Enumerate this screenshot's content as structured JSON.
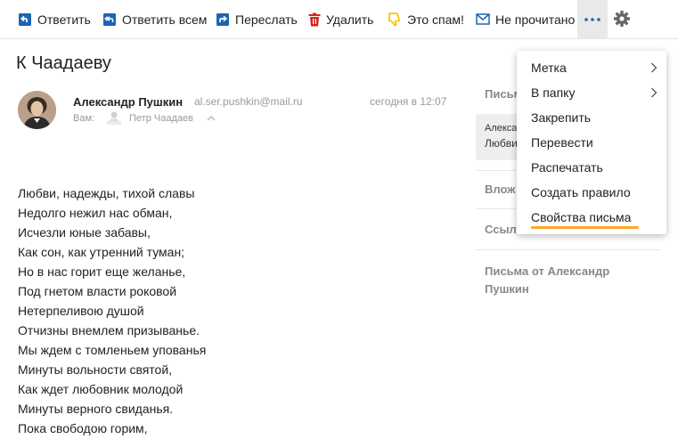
{
  "toolbar": {
    "reply": "Ответить",
    "reply_all": "Ответить всем",
    "forward": "Переслать",
    "delete": "Удалить",
    "spam": "Это спам!",
    "unread": "Не прочитано",
    "accent_color": "#1e63b4",
    "delete_color": "#d9231a",
    "spam_color": "#ffc400"
  },
  "message": {
    "subject": "К Чаадаеву",
    "sender_name": "Александр Пушкин",
    "sender_email": "al.ser.pushkin@mail.ru",
    "time": "сегодня в 12:07",
    "to_label": "Вам:",
    "to_name": "Петр Чаадаев",
    "body_lines": [
      "Любви, надежды, тихой славы",
      "Недолго нежил нас обман,",
      "Исчезли юные забавы,",
      "Как сон, как утренний туман;",
      "Но в нас горит еще желанье,",
      "Под гнетом власти роковой",
      "Нетерпеливою душой",
      "Отчизны внемлем призыванье.",
      "Мы ждем с томленьем упованья",
      "Минуты вольности святой,",
      "Как ждет любовник молодой",
      "Минуты верного свиданья.",
      "Пока свободою горим,"
    ]
  },
  "sidebar": {
    "letters_head": "Письм",
    "card_line1": "Алекса",
    "card_line2": "Любви",
    "attachments_head": "Влож",
    "links_head": "Ссыл",
    "from_sender": "Письма от Александр Пушкин"
  },
  "menu": {
    "items": [
      {
        "label": "Метка",
        "submenu": true
      },
      {
        "label": "В папку",
        "submenu": true
      },
      {
        "label": "Закрепить",
        "submenu": false
      },
      {
        "label": "Перевести",
        "submenu": false
      },
      {
        "label": "Распечатать",
        "submenu": false
      },
      {
        "label": "Создать правило",
        "submenu": false
      },
      {
        "label": "Свойства письма",
        "submenu": false,
        "highlighted": true
      }
    ],
    "highlight_color": "#ffa726"
  }
}
